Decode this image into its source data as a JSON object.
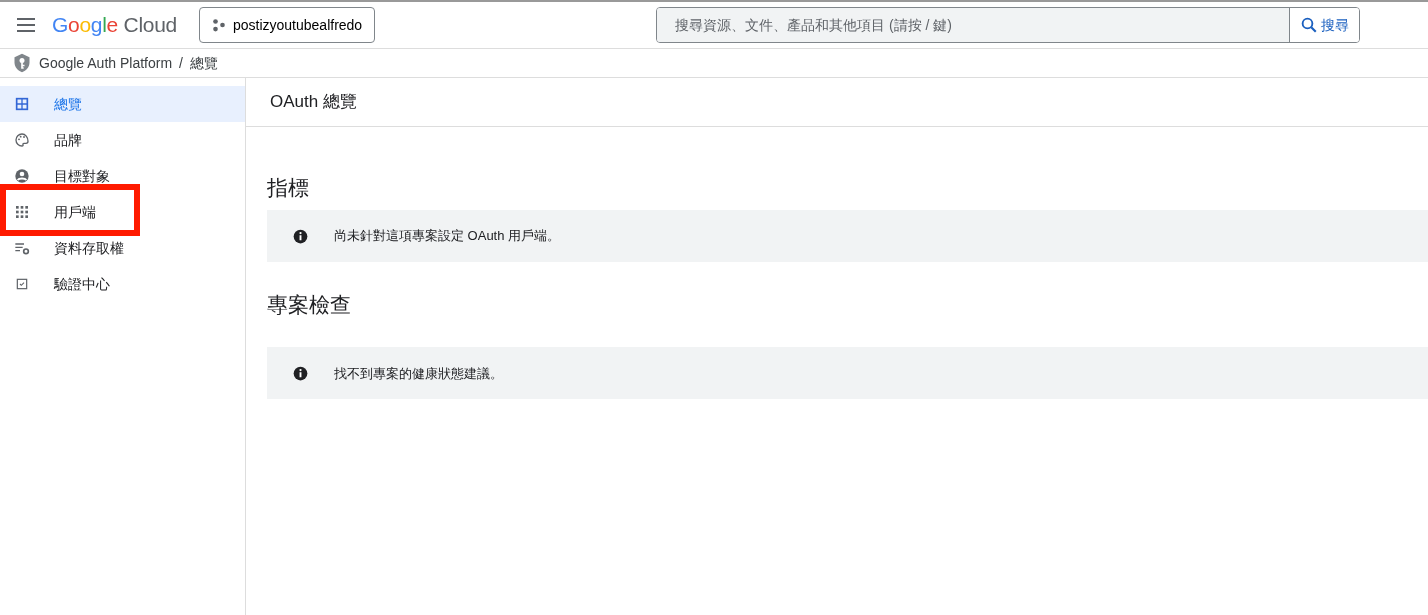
{
  "header": {
    "logo": "Google Cloud",
    "project": "postizyoutubealfredo",
    "search": {
      "placeholder": "搜尋資源、文件、產品和其他項目 (請按 / 鍵)"
    },
    "search_button": "搜尋"
  },
  "breadcrumb": [
    "Google Auth Platform",
    "/",
    "總覽"
  ],
  "sidebar": {
    "items": [
      {
        "label": "總覽",
        "selected": true,
        "highlighted": false
      },
      {
        "label": "品牌",
        "selected": false,
        "highlighted": false
      },
      {
        "label": "目標對象",
        "selected": false,
        "highlighted": false
      },
      {
        "label": "用戶端",
        "selected": false,
        "highlighted": true
      },
      {
        "label": "資料存取權",
        "selected": false,
        "highlighted": false
      },
      {
        "label": "驗證中心",
        "selected": false,
        "highlighted": false
      }
    ]
  },
  "page_title": "OAuth 總覽",
  "sections": [
    {
      "heading": "指標",
      "notice": "尚未針對這項專案設定 OAuth 用戶端。"
    },
    {
      "heading": "專案檢查",
      "notice": "找不到專案的健康狀態建議。"
    }
  ]
}
